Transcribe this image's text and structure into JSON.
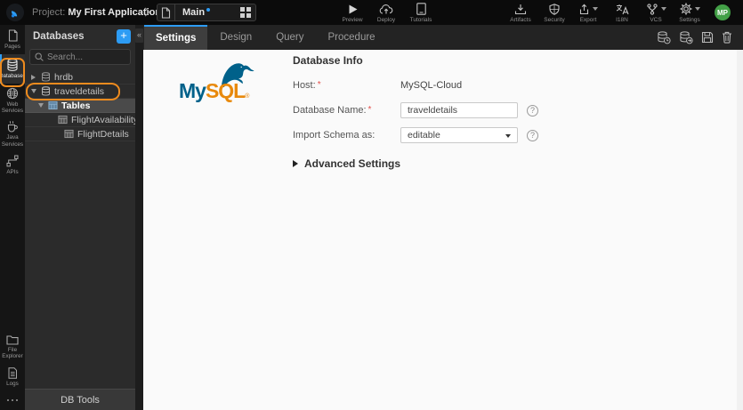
{
  "topbar": {
    "project_label": "Project:",
    "project_name": "My First Application",
    "page_selector": {
      "name": "Main"
    },
    "actions": [
      {
        "label": "Preview"
      },
      {
        "label": "Deploy"
      },
      {
        "label": "Tutorials"
      },
      {
        "label": "Artifacts"
      },
      {
        "label": "Security"
      },
      {
        "label": "Export"
      },
      {
        "label": "I18N"
      },
      {
        "label": "VCS"
      },
      {
        "label": "Settings"
      }
    ],
    "avatar_initials": "MP"
  },
  "rail": {
    "items": [
      {
        "label": "Pages",
        "active": false
      },
      {
        "label": "Databases",
        "active": true
      },
      {
        "label": "Web Services",
        "active": false
      },
      {
        "label": "Java Services",
        "active": false
      },
      {
        "label": "APIs",
        "active": false
      }
    ],
    "bottom_items": [
      {
        "label": "File Explorer"
      },
      {
        "label": "Logs"
      }
    ]
  },
  "panel": {
    "title": "Databases",
    "add_button": "+",
    "collapse_glyph": "«",
    "search_placeholder": "Search...",
    "tree": [
      {
        "label": "hrdb",
        "type": "database",
        "level": 0,
        "expanded": false
      },
      {
        "label": "traveldetails",
        "type": "database",
        "level": 0,
        "expanded": true,
        "annotated": true
      },
      {
        "label": "Tables",
        "type": "table-group",
        "level": 1,
        "expanded": true,
        "selected": true
      },
      {
        "label": "FlightAvailability",
        "type": "table",
        "level": 2
      },
      {
        "label": "FlightDetails",
        "type": "table",
        "level": 2
      }
    ],
    "footer": "DB Tools"
  },
  "main": {
    "tabs": [
      {
        "label": "Settings",
        "active": true
      },
      {
        "label": "Design",
        "active": false
      },
      {
        "label": "Query",
        "active": false
      },
      {
        "label": "Procedure",
        "active": false
      }
    ],
    "toolbar_icons": [
      "reimport-database",
      "export-database",
      "save",
      "delete"
    ],
    "logo": {
      "my": "My",
      "sql": "SQL",
      "reg": "®"
    },
    "form": {
      "heading": "Database Info",
      "required_marker": "*",
      "help_glyph": "?",
      "host_label": "Host:",
      "host_value": "MySQL-Cloud",
      "dbname_label": "Database Name:",
      "dbname_value": "traveldetails",
      "import_label": "Import Schema as:",
      "import_value": "editable",
      "advanced_label": "Advanced Settings"
    }
  },
  "colors": {
    "accent_blue": "#2d9cf4",
    "annotation_orange": "#ee8b1e",
    "avatar_green": "#43a047",
    "mysql_blue": "#00618a",
    "mysql_orange": "#e8890c",
    "required_red": "#e4504c"
  }
}
